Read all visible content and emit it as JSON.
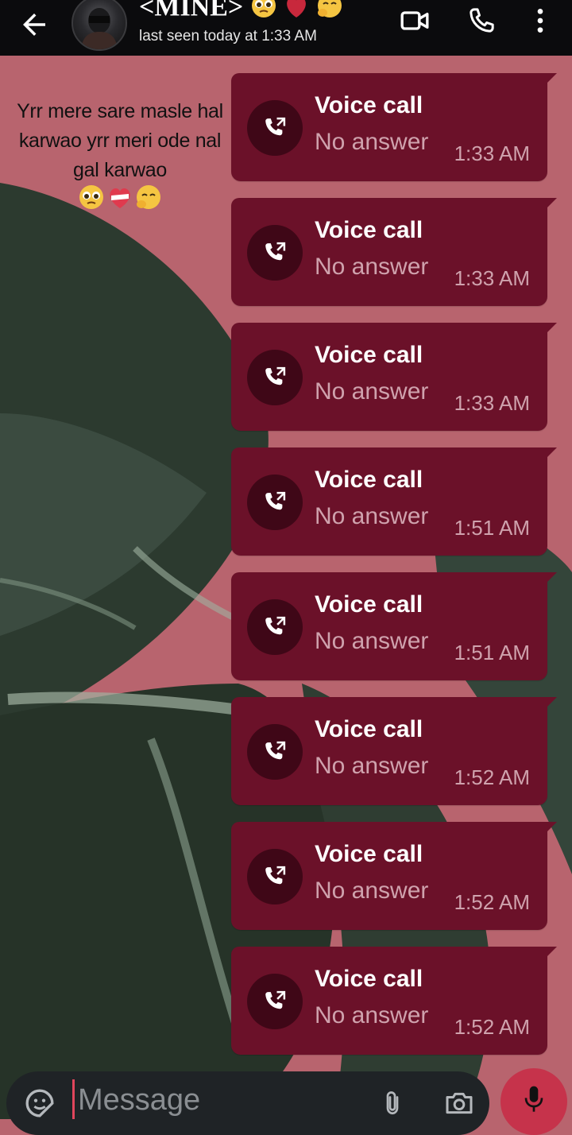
{
  "header": {
    "contact_name": "<MINE>",
    "last_seen": "last seen today at 1:33 AM",
    "icons": [
      "arrow-left-icon",
      "video-camera-icon",
      "phone-icon",
      "more-vertical-icon"
    ]
  },
  "incoming_message": {
    "text": "Yrr mere sare masle hal  karwao yrr meri ode nal gal karwao",
    "emojis": [
      "pleading-face",
      "mending-heart",
      "face-holding-back-tears"
    ]
  },
  "calls": [
    {
      "title": "Voice call",
      "status": "No answer",
      "time": "1:33 AM"
    },
    {
      "title": "Voice call",
      "status": "No answer",
      "time": "1:33 AM"
    },
    {
      "title": "Voice call",
      "status": "No answer",
      "time": "1:33 AM"
    },
    {
      "title": "Voice call",
      "status": "No answer",
      "time": "1:51 AM"
    },
    {
      "title": "Voice call",
      "status": "No answer",
      "time": "1:51 AM"
    },
    {
      "title": "Voice call",
      "status": "No answer",
      "time": "1:52 AM"
    },
    {
      "title": "Voice call",
      "status": "No answer",
      "time": "1:52 AM"
    },
    {
      "title": "Voice call",
      "status": "No answer",
      "time": "1:52 AM"
    }
  ],
  "composer": {
    "placeholder": "Message",
    "icons": [
      "sticker-icon",
      "paperclip-icon",
      "camera-icon",
      "microphone-icon"
    ]
  },
  "colors": {
    "header_bg": "#0b0b0d",
    "bubble_bg": "#6b1129",
    "bubble_icon_bg": "#3f0717",
    "wallpaper_pink": "#b8646e",
    "mic_button": "#c6334b",
    "composer_bg": "#1f2326"
  }
}
